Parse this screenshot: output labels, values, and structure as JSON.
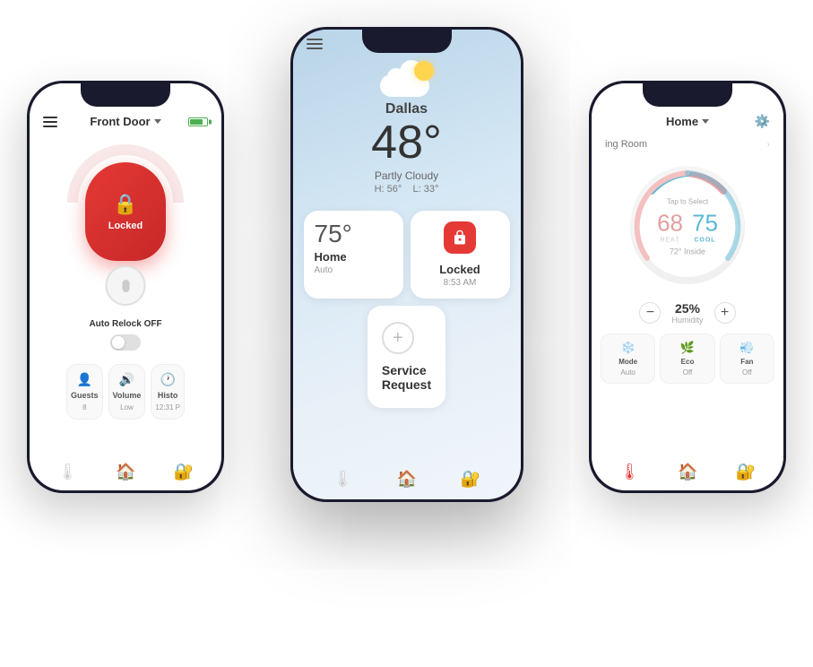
{
  "left_phone": {
    "title": "Front Door",
    "status": "Locked",
    "auto_relock_label": "Auto Relock",
    "auto_relock_state": "OFF",
    "tiles": [
      {
        "label": "Guests",
        "value": "8",
        "icon": "👤"
      },
      {
        "label": "Volume",
        "value": "Low",
        "icon": "🔊"
      },
      {
        "label": "Histo",
        "value": "12:31 P",
        "icon": "🕐"
      }
    ]
  },
  "center_phone": {
    "city": "Dallas",
    "temperature": "48°",
    "condition": "Partly Cloudy",
    "high": "H: 56°",
    "low": "L: 33°",
    "home_temp": "75°",
    "home_label": "Home",
    "home_sub": "Auto",
    "locked_label": "Locked",
    "locked_time": "8:53 AM",
    "service_label": "Service",
    "service_sub": "Request"
  },
  "right_phone": {
    "title": "Home",
    "room": "ing Room",
    "tap_label": "Tap to Select",
    "heat_temp": "68",
    "heat_label": "HEAT",
    "cool_temp": "75",
    "cool_label": "COOL",
    "inside_temp": "72° Inside",
    "humidity_pct": "25%",
    "humidity_label": "Humidity",
    "tiles": [
      {
        "label": "Mode",
        "value": "Auto",
        "icon": "❄️"
      },
      {
        "label": "Eco",
        "value": "Off",
        "icon": "🌿"
      },
      {
        "label": "Fan",
        "value": "Off",
        "icon": "💨"
      }
    ]
  }
}
